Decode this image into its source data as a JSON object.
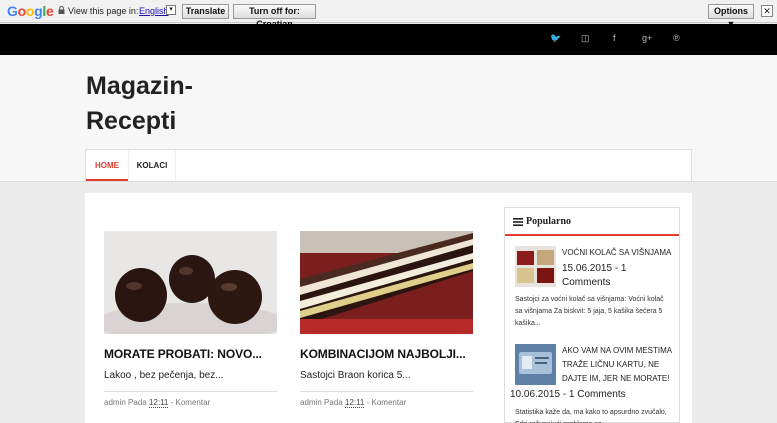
{
  "translate_bar": {
    "logo": [
      "G",
      "o",
      "o",
      "g",
      "l",
      "e"
    ],
    "view_text": "View this page in:",
    "language": "English",
    "translate_label": "Translate",
    "turnoff_label": "Turn off for: Croatian",
    "options_label": "Options ▼",
    "close_label": "✕"
  },
  "social": [
    {
      "icon": "twitter-icon",
      "glyph": "🐦"
    },
    {
      "icon": "instagram-icon",
      "glyph": "◫"
    },
    {
      "icon": "facebook-icon",
      "glyph": "f"
    },
    {
      "icon": "google-plus-icon",
      "glyph": "g+"
    },
    {
      "icon": "pinterest-icon",
      "glyph": "℗"
    }
  ],
  "site": {
    "title": "Magazin-Recepti"
  },
  "nav": {
    "home": "HOME",
    "kolaci": "KOLACI"
  },
  "posts": [
    {
      "title": "MORATE PROBATI: NOVO...",
      "snippet": "Lakoo , bez pečenja, bez...",
      "author": "admin",
      "pada": "Pada",
      "time": "12:11",
      "comment": "Komentar"
    },
    {
      "title": "KOMBINACIJOM NAJBOLJI...",
      "snippet": "Sastojci Braon korica 5...",
      "author": "admin",
      "pada": "Pada",
      "time": "12:11",
      "comment": "Komentar"
    }
  ],
  "sidebar": {
    "heading": "Popularno",
    "items": [
      {
        "title": "VOĆNI KOLAČ SA VIŠNJAMA",
        "date": "15.06.2015 - 1 Comments",
        "desc": "Sastojci za voćni kolač sa višnjama: Voćni kolač sa višnjama Za biskvit: 5 jaja, 5 kašika šećera 5 kašika..."
      },
      {
        "title": "AKO VAM NA OVIM MESTIMA TRAŽE LIČNU KARTU, NE DAJTE IM, JER NE MORATE!",
        "date": "10.06.2015 - 1 Comments",
        "desc": "Statistika kaže da, ma kako to apsurdno zvučalo, Srbi računajući probleme sa ..."
      }
    ]
  },
  "colors": {
    "accent": "#e03b2f",
    "topbar": "#000000",
    "header_bg": "#f7f7f7"
  }
}
